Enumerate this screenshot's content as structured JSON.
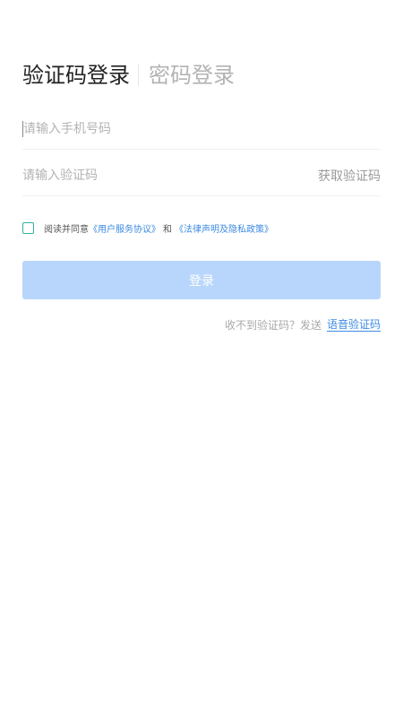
{
  "tabs": {
    "sms_login": "验证码登录",
    "password_login": "密码登录"
  },
  "phone": {
    "placeholder": "请输入手机号码",
    "value": ""
  },
  "code": {
    "placeholder": "请输入验证码",
    "value": "",
    "get_code_label": "获取验证码"
  },
  "agreement": {
    "checked": false,
    "prefix": "阅读并同意",
    "user_agreement": "《用户服务协议》",
    "and": "和",
    "privacy_policy": "《法律声明及隐私政策》"
  },
  "login_button": "登录",
  "voice": {
    "hint": "收不到验证码？发送",
    "link": "语音验证码"
  },
  "colors": {
    "accent_link": "#3c8ae0",
    "button_disabled": "#b8d6fb",
    "checkbox_border": "#2fb0a0",
    "inactive_tab": "#b3b3b3"
  }
}
